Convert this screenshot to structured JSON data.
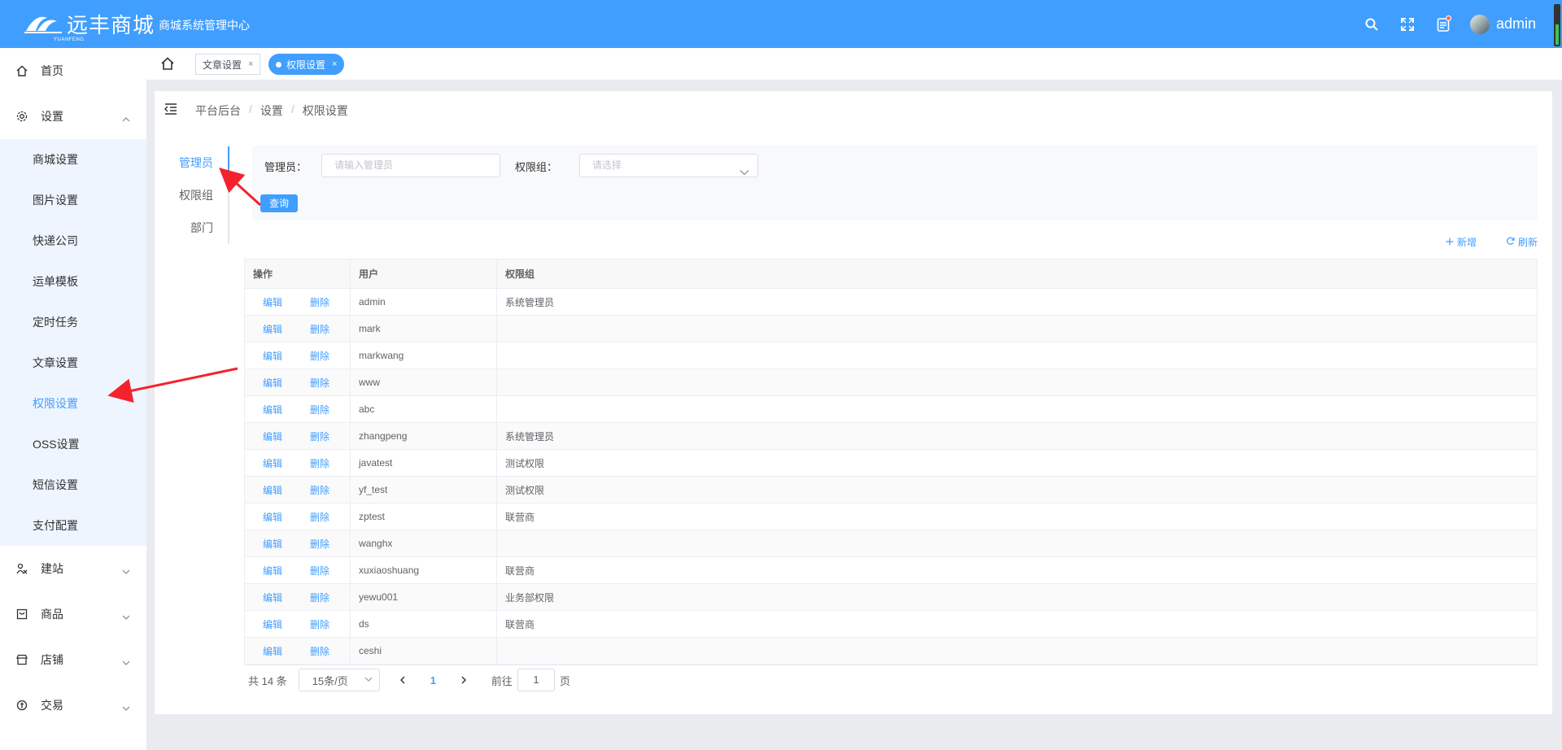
{
  "header": {
    "logo_text": "远丰商城",
    "logo_sub": "YUANFENG",
    "subtitle": "商城系统管理中心",
    "username": "admin",
    "icons": [
      "search-icon",
      "fullscreen-icon",
      "notification-icon",
      "avatar"
    ],
    "battery_level": 0.5
  },
  "colors": {
    "primary": "#409eff",
    "danger": "#f56c6c"
  },
  "sidebar": {
    "items": [
      {
        "label": "首页",
        "icon": "home-icon"
      },
      {
        "label": "设置",
        "icon": "gear-icon",
        "expanded": true
      }
    ],
    "sub_items": [
      "商城设置",
      "图片设置",
      "快递公司",
      "运单模板",
      "定时任务",
      "文章设置",
      "权限设置",
      "OSS设置",
      "短信设置",
      "支付配置"
    ],
    "active_sub": "权限设置",
    "bottom_items": [
      {
        "label": "建站",
        "icon": "site-icon"
      },
      {
        "label": "商品",
        "icon": "goods-icon"
      },
      {
        "label": "店铺",
        "icon": "store-icon"
      },
      {
        "label": "交易",
        "icon": "trade-icon"
      }
    ]
  },
  "tabs": [
    {
      "label": "文章设置",
      "close": "×"
    },
    {
      "label": "权限设置",
      "close": "×",
      "active": true
    }
  ],
  "breadcrumb": [
    "平台后台",
    "设置",
    "权限设置"
  ],
  "breadcrumb_sep": "/",
  "vertical_tabs": [
    "管理员",
    "权限组",
    "部门"
  ],
  "filter": {
    "admin_label": "管理员：",
    "admin_placeholder": "请输入管理员",
    "group_label": "权限组：",
    "group_placeholder": "请选择",
    "query_button": "查询"
  },
  "toolbar": {
    "add": "新增",
    "refresh": "刷新"
  },
  "table": {
    "headers": [
      "操作",
      "用户",
      "权限组"
    ],
    "edit_label": "编辑",
    "delete_label": "删除",
    "rows": [
      {
        "user": "admin",
        "group": "系统管理员"
      },
      {
        "user": "mark",
        "group": ""
      },
      {
        "user": "markwang",
        "group": ""
      },
      {
        "user": "www",
        "group": ""
      },
      {
        "user": "abc",
        "group": ""
      },
      {
        "user": "zhangpeng",
        "group": "系统管理员"
      },
      {
        "user": "javatest",
        "group": "测试权限"
      },
      {
        "user": "yf_test",
        "group": "测试权限"
      },
      {
        "user": "zptest",
        "group": "联营商"
      },
      {
        "user": "wanghx",
        "group": ""
      },
      {
        "user": "xuxiaoshuang",
        "group": "联营商"
      },
      {
        "user": "yewu001",
        "group": "业务部权限"
      },
      {
        "user": "ds",
        "group": "联营商"
      },
      {
        "user": "ceshi",
        "group": ""
      }
    ]
  },
  "pagination": {
    "total": "共 14 条",
    "page_size": "15条/页",
    "current": "1",
    "goto_prefix": "前往",
    "goto_value": "1",
    "goto_suffix": "页"
  }
}
